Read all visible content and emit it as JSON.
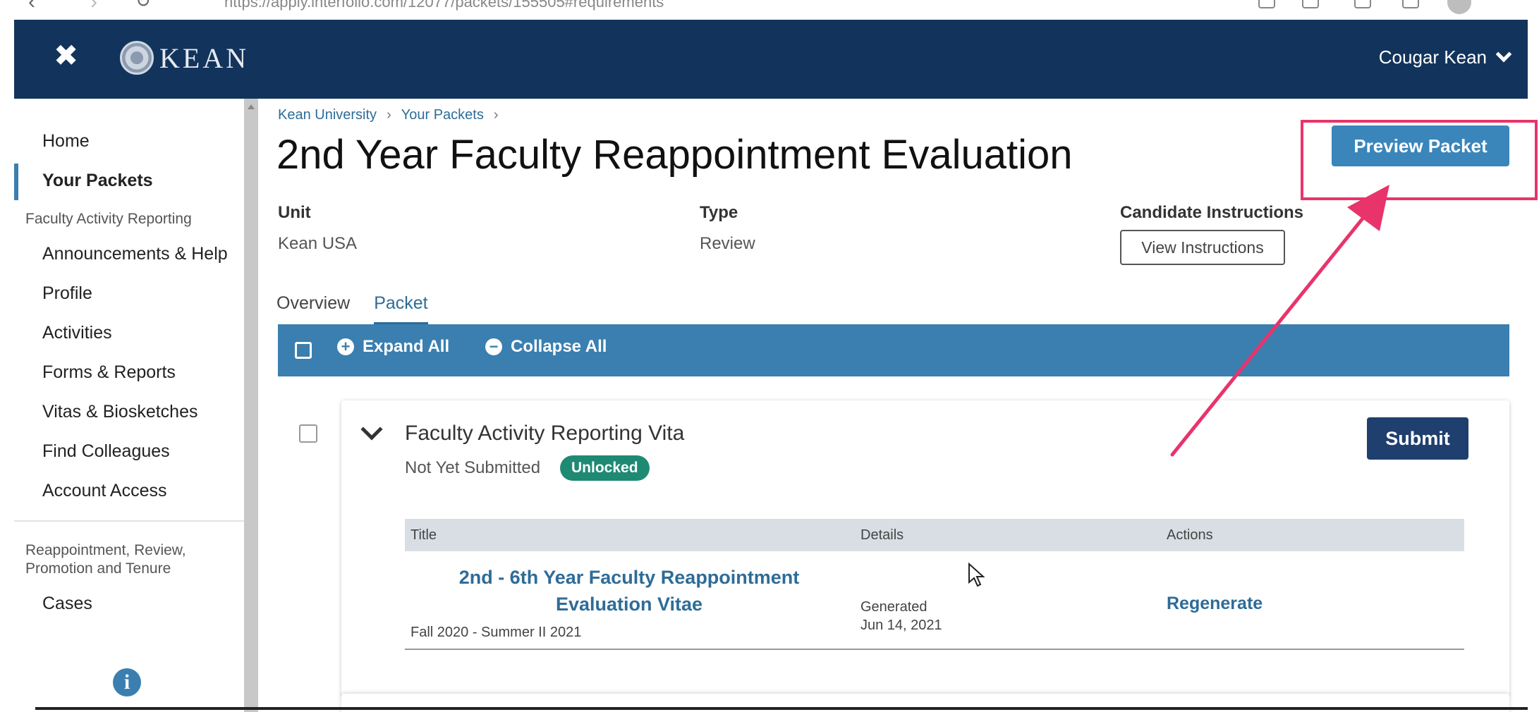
{
  "browser": {
    "url": "https://apply.interfolio.com/12077/packets/155505#requirements"
  },
  "header": {
    "logo_text": "KEAN",
    "user_name": "Cougar Kean"
  },
  "sidebar": {
    "items_top": [
      {
        "label": "Home",
        "active": false
      },
      {
        "label": "Your Packets",
        "active": true
      }
    ],
    "section1_title": "Faculty Activity Reporting",
    "items_far": [
      {
        "label": "Announcements & Help"
      },
      {
        "label": "Profile"
      },
      {
        "label": "Activities"
      },
      {
        "label": "Forms & Reports"
      },
      {
        "label": "Vitas & Biosketches"
      },
      {
        "label": "Find Colleagues"
      },
      {
        "label": "Account Access"
      }
    ],
    "section2_title_line1": "Reappointment, Review,",
    "section2_title_line2": "Promotion and Tenure",
    "items_rpt": [
      {
        "label": "Cases"
      }
    ],
    "footer_icon": "info-icon"
  },
  "breadcrumb": [
    "Kean University",
    "Your Packets"
  ],
  "page": {
    "title": "2nd Year Faculty Reappointment Evaluation",
    "preview_label": "Preview Packet",
    "unit_label": "Unit",
    "unit_value": "Kean USA",
    "type_label": "Type",
    "type_value": "Review",
    "instructions_label": "Candidate Instructions",
    "instructions_button": "View Instructions"
  },
  "tabs": [
    {
      "label": "Overview",
      "active": false
    },
    {
      "label": "Packet",
      "active": true
    }
  ],
  "toolbar": {
    "expand_label": "Expand All",
    "collapse_label": "Collapse All"
  },
  "requirement": {
    "title": "Faculty Activity Reporting Vita",
    "status": "Not Yet Submitted",
    "badge": "Unlocked",
    "submit_label": "Submit",
    "table": {
      "headers": [
        "Title",
        "Details",
        "Actions"
      ],
      "rows": [
        {
          "title": "2nd - 6th Year Faculty Reappointment Evaluation Vitae",
          "term": "Fall 2020 - Summer II 2021",
          "details_line1": "Generated",
          "details_line2": "Jun 14, 2021",
          "action": "Regenerate"
        }
      ]
    }
  },
  "colors": {
    "header_bg": "#12345c",
    "accent": "#3a7fb0",
    "submit_bg": "#1f3f6e",
    "badge_bg": "#1f8a73",
    "annotation": "#e8346b"
  }
}
